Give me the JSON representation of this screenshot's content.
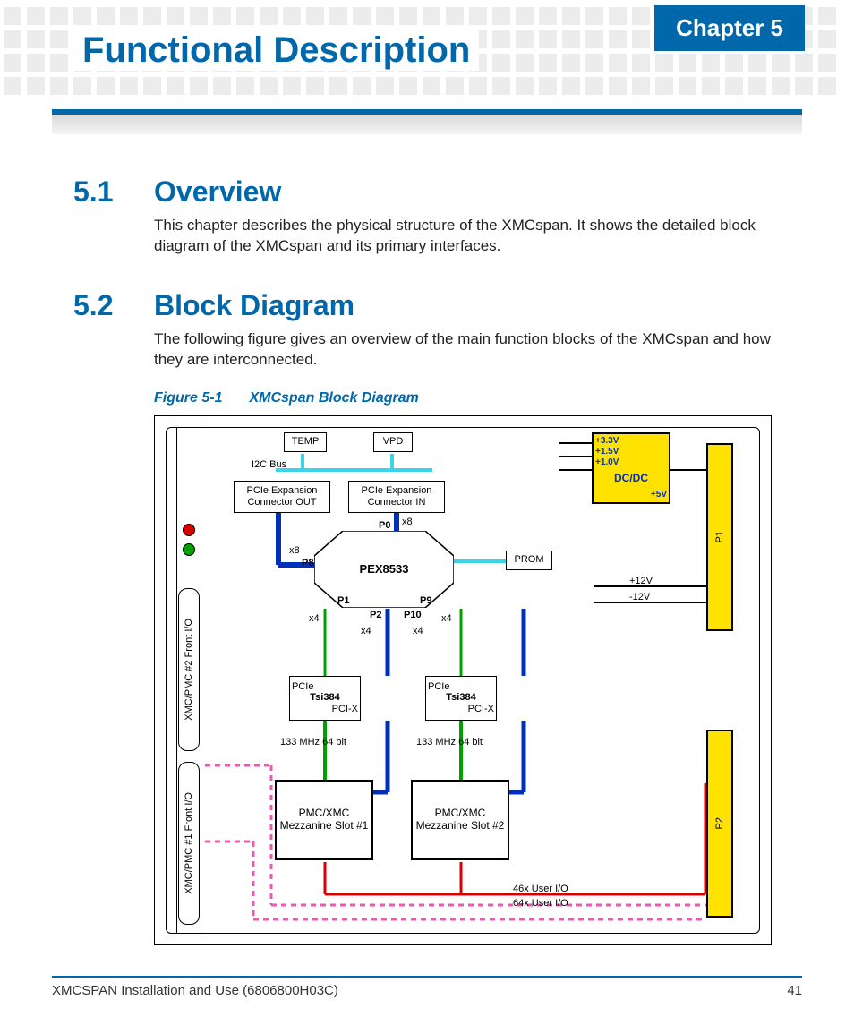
{
  "chapter_tab": "Chapter 5",
  "page_title": "Functional Description",
  "sections": [
    {
      "num": "5.1",
      "title": "Overview",
      "body": "This chapter describes the physical structure of the XMCspan. It shows the detailed block diagram of the XMCspan and its primary interfaces."
    },
    {
      "num": "5.2",
      "title": "Block Diagram",
      "body": "The following figure gives an overview of the main function blocks of the XMCspan and how they are interconnected."
    }
  ],
  "figure": {
    "label": "Figure 5-1",
    "caption": "XMCspan Block Diagram"
  },
  "diagram": {
    "front_io": [
      "XMC/PMC #2 Front I/O",
      "XMC/PMC #1 Front I/O"
    ],
    "temp": "TEMP",
    "vpd": "VPD",
    "i2c": "I2C Bus",
    "pcie_out": "PCIe Expansion Connector OUT",
    "pcie_in": "PCIe Expansion Connector IN",
    "switch": "PEX8533",
    "ports": {
      "p0": "P0",
      "p1": "P1",
      "p2": "P2",
      "p8": "P8",
      "p9": "P9",
      "p10": "P10"
    },
    "lanes": {
      "x8a": "x8",
      "x8b": "x8",
      "x4a": "x4",
      "x4b": "x4",
      "x4c": "x4",
      "x4d": "x4"
    },
    "prom": "PROM",
    "bridge": {
      "pcie": "PCIe",
      "name": "Tsi384",
      "pcix": "PCI-X"
    },
    "bus": "133 MHz  64 bit",
    "slot1": "PMC/XMC Mezzanine Slot #1",
    "slot2": "PMC/XMC Mezzanine Slot #2",
    "user_io": {
      "a": "46x User I/O",
      "b": "64x User I/O"
    },
    "dcdc": {
      "name": "DC/DC",
      "out": [
        "+3.3V",
        "+1.5V",
        "+1.0V"
      ],
      "in": "+5V"
    },
    "rails": {
      "p12": "+12V",
      "n12": "-12V"
    },
    "conn": {
      "p1": "P1",
      "p2": "P2"
    }
  },
  "footer": {
    "doc": "XMCSPAN Installation and Use (6806800H03C)",
    "page": "41"
  }
}
